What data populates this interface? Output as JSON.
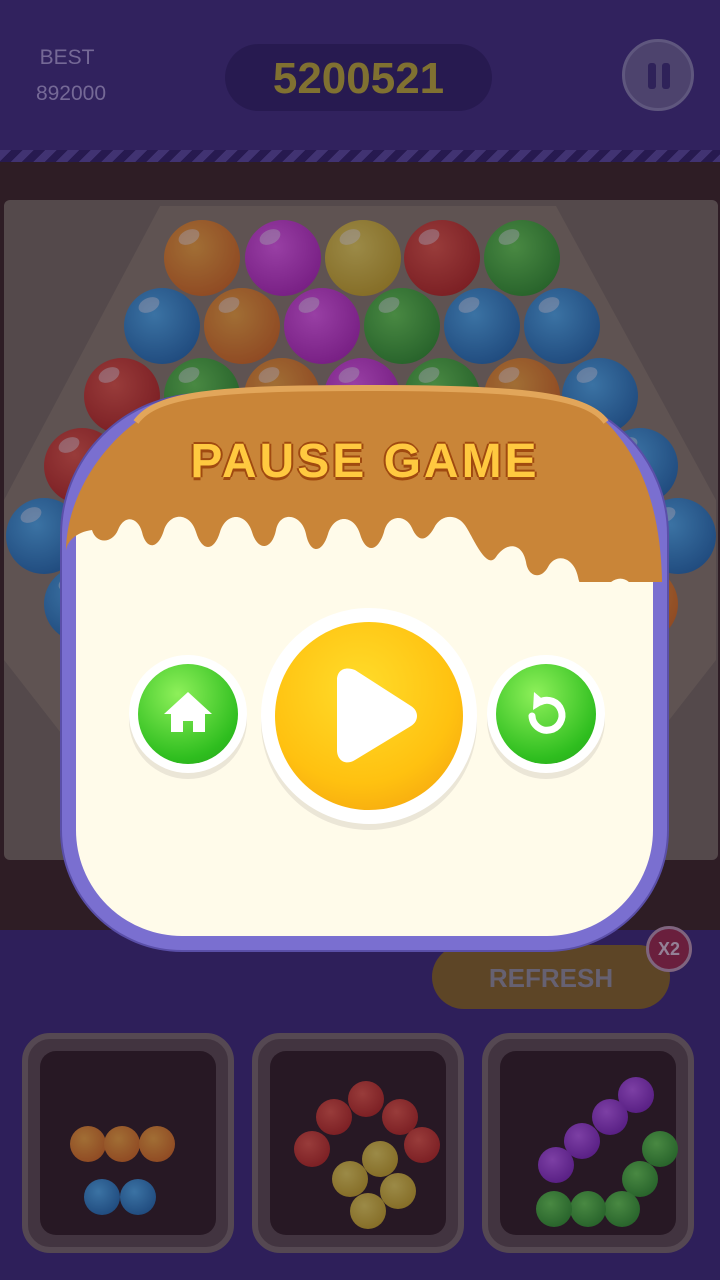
{
  "header": {
    "best_label": "BEST",
    "best_value": "892000",
    "score": "5200521"
  },
  "dialog": {
    "title": "PAUSE GAME"
  },
  "refresh": {
    "label": "REFRESH",
    "multiplier": "X2"
  },
  "colors": {
    "background": "#3f2d78",
    "dialog_border": "#7a6fd0",
    "dialog_fill": "#fffbea",
    "caramel": "#c98538",
    "score_text": "#c7b52a",
    "bubble_orange": "#f28a1a",
    "bubble_magenta": "#d33bd3",
    "bubble_yellow": "#e3c51a",
    "bubble_red": "#d8301a",
    "bubble_green": "#37b82a",
    "bubble_blue": "#1f8fcf",
    "bubble_purple": "#9c3fcf"
  },
  "icons": [
    "pause-icon",
    "home-icon",
    "play-icon",
    "restart-icon"
  ]
}
